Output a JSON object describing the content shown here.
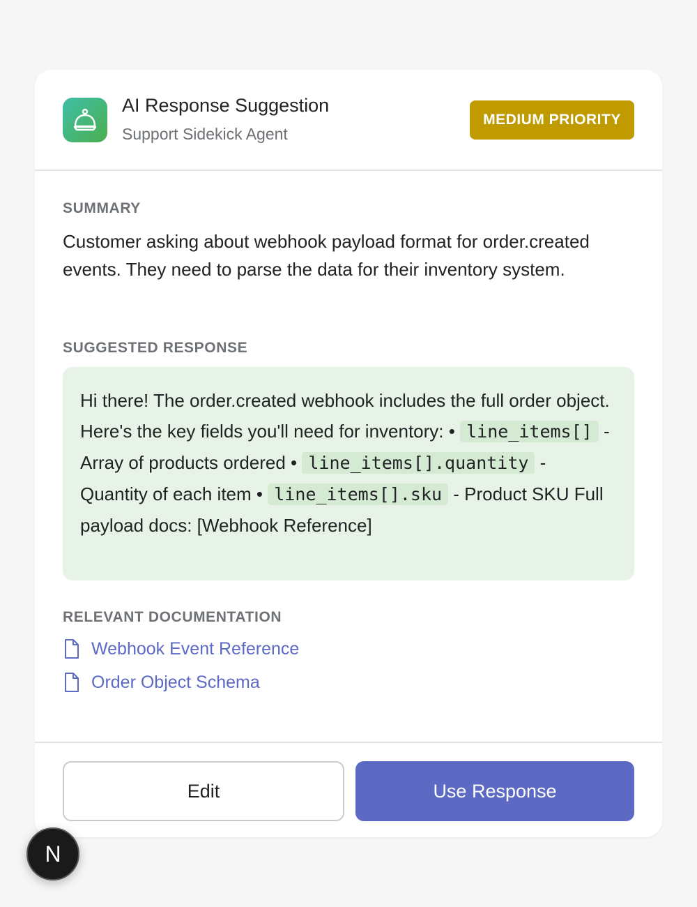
{
  "header": {
    "title": "AI Response Suggestion",
    "subtitle": "Support Sidekick Agent",
    "priority": "MEDIUM PRIORITY",
    "app_icon": "bot-icon"
  },
  "summary": {
    "label": "SUMMARY",
    "text": "Customer asking about webhook payload format for order.created events. They need to parse the data for their inventory system."
  },
  "suggested_response": {
    "label": "SUGGESTED RESPONSE",
    "intro": "Hi there! The order.created webhook includes the full order object. Here's the key fields you'll need for inventory: •",
    "field1_code": "line_items[]",
    "field1_desc": " - Array of products ordered •",
    "field2_code": "line_items[].quantity",
    "field2_desc": " - Quantity of each item •",
    "field3_code": "line_items[].sku",
    "field3_desc": " - Product SKU Full payload docs: [Webhook Reference]"
  },
  "docs": {
    "label": "RELEVANT DOCUMENTATION",
    "links": [
      {
        "label": "Webhook Event Reference",
        "icon": "document-icon"
      },
      {
        "label": "Order Object Schema",
        "icon": "document-icon"
      }
    ]
  },
  "actions": {
    "edit_label": "Edit",
    "use_label": "Use Response"
  },
  "dev_badge": {
    "letter": "N"
  },
  "colors": {
    "priority_bg": "#c09b00",
    "primary": "#5c6ac4",
    "response_bg": "#e8f3e7",
    "icon_gradient_start": "#3ebfa6",
    "icon_gradient_end": "#4caf50"
  }
}
